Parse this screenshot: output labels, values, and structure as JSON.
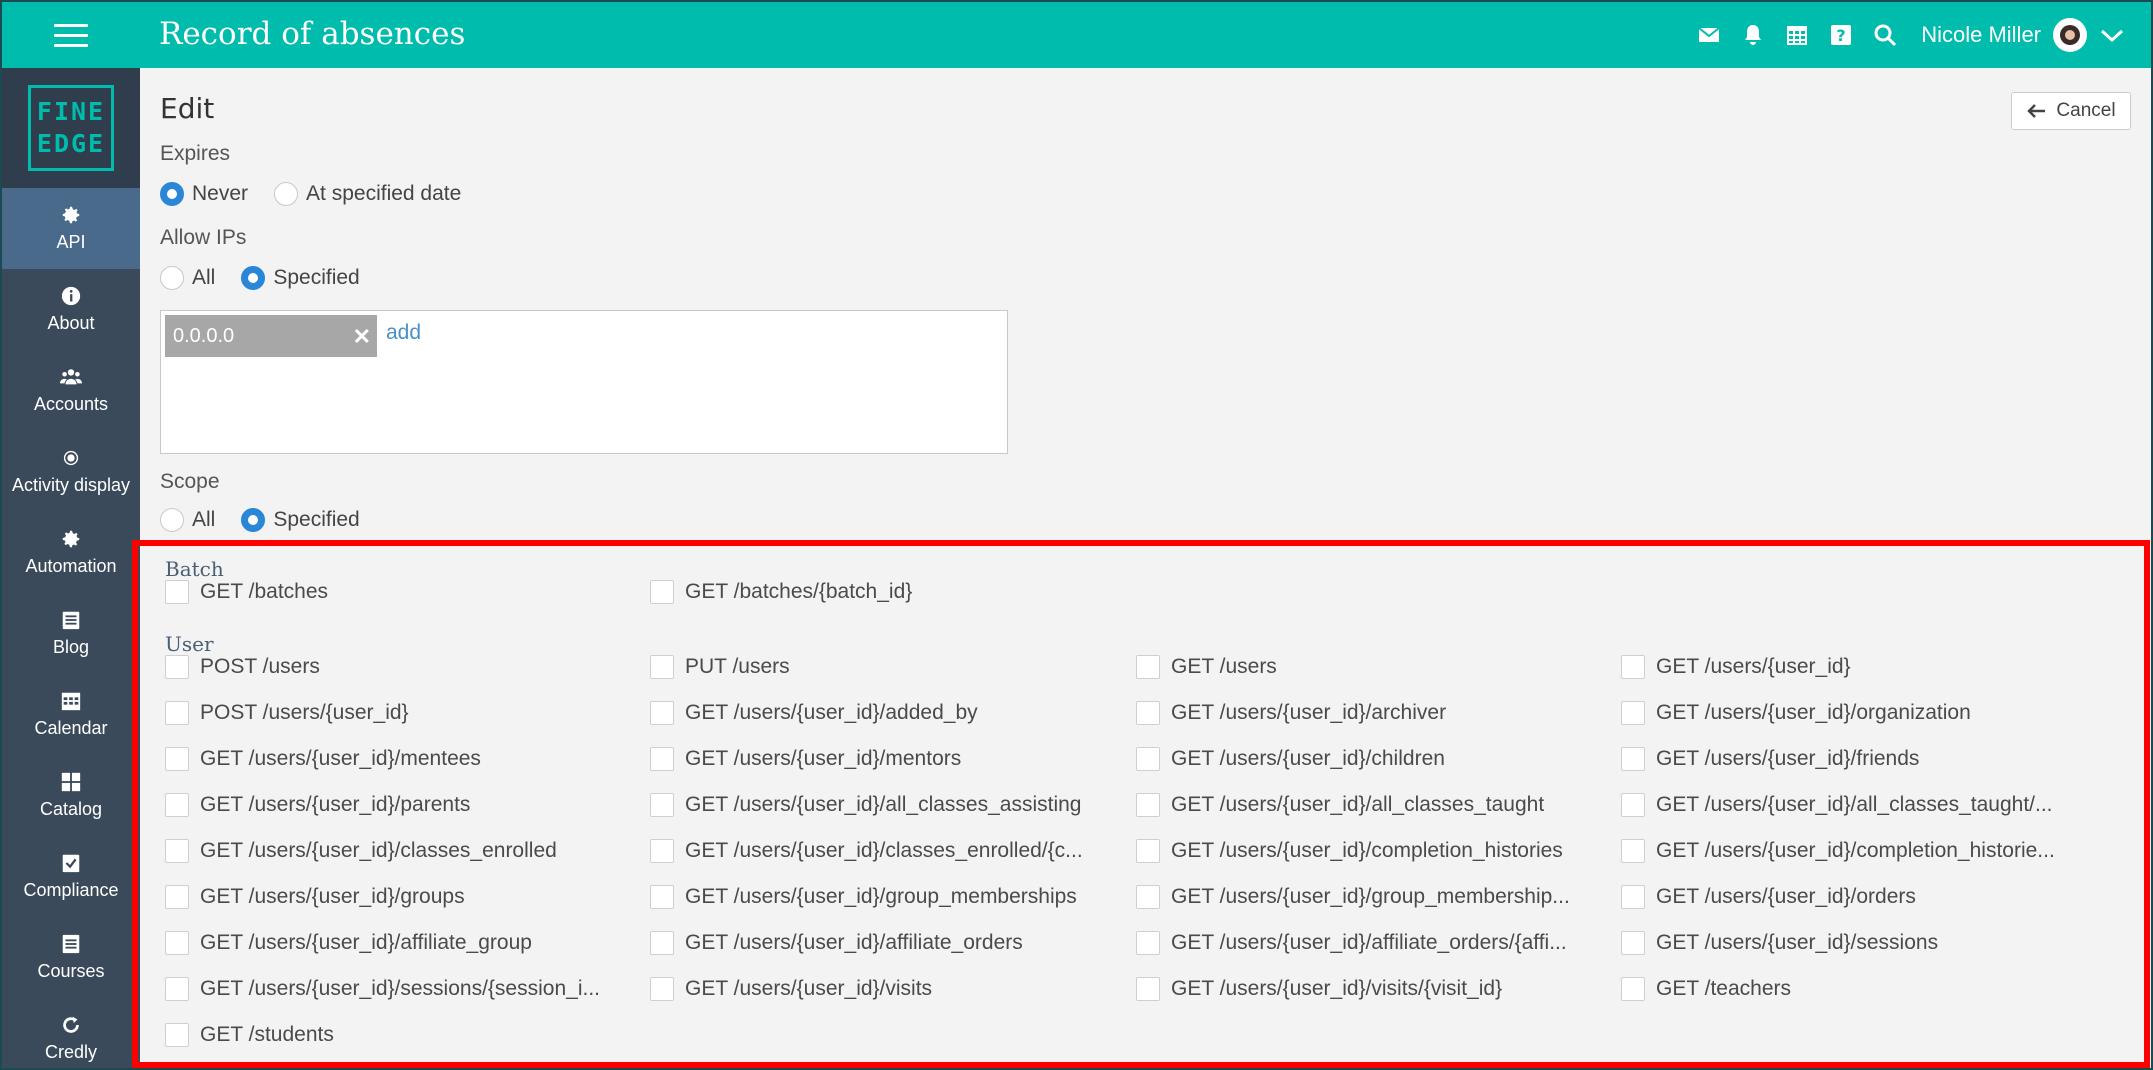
{
  "header": {
    "title": "Record of absences",
    "user_name": "Nicole Miller",
    "icons": [
      "menu-icon",
      "mail-icon",
      "bell-icon",
      "calendar-icon",
      "help-icon",
      "search-icon",
      "chevron-down-icon"
    ]
  },
  "logo": {
    "line1": "FINE",
    "line2": "EDGE"
  },
  "sidebar": {
    "items": [
      {
        "label": "API",
        "icon": "gear-icon",
        "active": true
      },
      {
        "label": "About",
        "icon": "info-icon"
      },
      {
        "label": "Accounts",
        "icon": "users-icon"
      },
      {
        "label": "Activity display",
        "icon": "dot-icon"
      },
      {
        "label": "Automation",
        "icon": "gear-icon"
      },
      {
        "label": "Blog",
        "icon": "blog-icon"
      },
      {
        "label": "Calendar",
        "icon": "calendar-icon"
      },
      {
        "label": "Catalog",
        "icon": "grid-icon"
      },
      {
        "label": "Compliance",
        "icon": "check-square-icon"
      },
      {
        "label": "Courses",
        "icon": "book-icon"
      },
      {
        "label": "Credly",
        "icon": "refresh-icon"
      }
    ]
  },
  "form": {
    "title": "Edit",
    "cancel_label": "Cancel",
    "expires": {
      "label": "Expires",
      "options": [
        "Never",
        "At specified date"
      ],
      "selected": "Never"
    },
    "allow_ips": {
      "label": "Allow IPs",
      "options": [
        "All",
        "Specified"
      ],
      "selected": "Specified",
      "tags": [
        "0.0.0.0"
      ],
      "add_label": "add"
    },
    "scope": {
      "label": "Scope",
      "options": [
        "All",
        "Specified"
      ],
      "selected": "Specified"
    }
  },
  "scope_groups": [
    {
      "title": "Batch",
      "permissions": [
        "GET /batches",
        "GET /batches/{batch_id}"
      ]
    },
    {
      "title": "User",
      "permissions": [
        "POST /users",
        "PUT /users",
        "GET /users",
        "GET /users/{user_id}",
        "POST /users/{user_id}",
        "GET /users/{user_id}/added_by",
        "GET /users/{user_id}/archiver",
        "GET /users/{user_id}/organization",
        "GET /users/{user_id}/mentees",
        "GET /users/{user_id}/mentors",
        "GET /users/{user_id}/children",
        "GET /users/{user_id}/friends",
        "GET /users/{user_id}/parents",
        "GET /users/{user_id}/all_classes_assisting",
        "GET /users/{user_id}/all_classes_taught",
        "GET /users/{user_id}/all_classes_taught/...",
        "GET /users/{user_id}/classes_enrolled",
        "GET /users/{user_id}/classes_enrolled/{c...",
        "GET /users/{user_id}/completion_histories",
        "GET /users/{user_id}/completion_historie...",
        "GET /users/{user_id}/groups",
        "GET /users/{user_id}/group_memberships",
        "GET /users/{user_id}/group_membership...",
        "GET /users/{user_id}/orders",
        "GET /users/{user_id}/affiliate_group",
        "GET /users/{user_id}/affiliate_orders",
        "GET /users/{user_id}/affiliate_orders/{affi...",
        "GET /users/{user_id}/sessions",
        "GET /users/{user_id}/sessions/{session_i...",
        "GET /users/{user_id}/visits",
        "GET /users/{user_id}/visits/{visit_id}",
        "GET /teachers",
        "GET /students"
      ]
    }
  ],
  "colors": {
    "topbar": "#00bcad",
    "sidebar": "#3a4a5a",
    "sidebar_active": "#4a6a8c",
    "radio_selected": "#2a86d6",
    "highlight_border": "#ff0000"
  }
}
